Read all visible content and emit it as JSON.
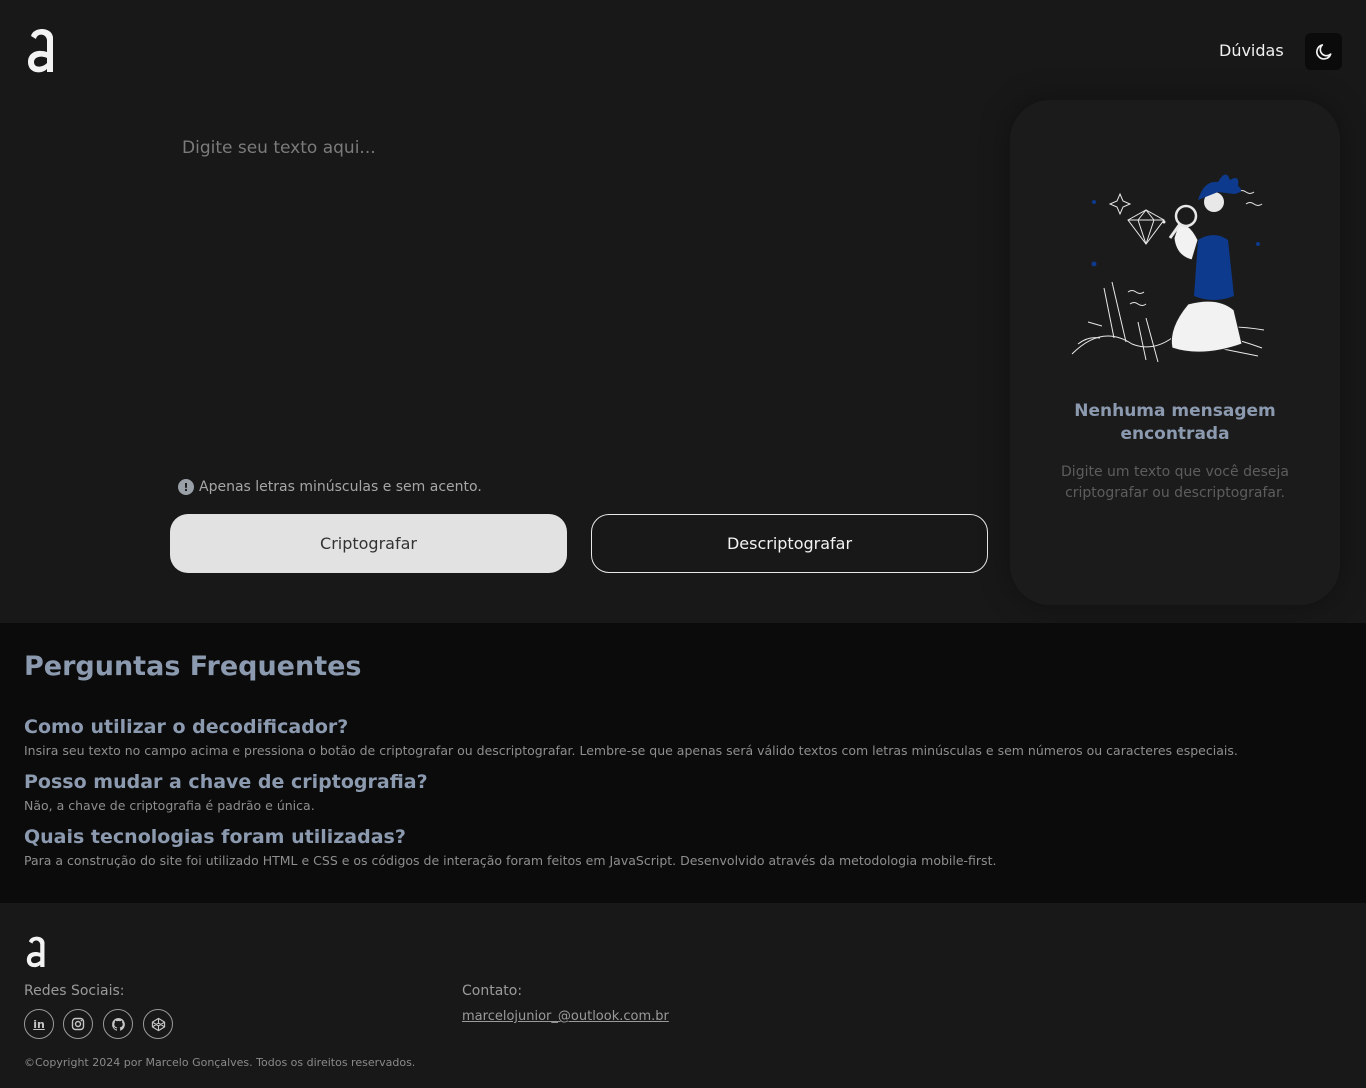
{
  "header": {
    "logo_letter": "a",
    "nav_link": "Dúvidas",
    "theme_icon": "moon-icon"
  },
  "input": {
    "placeholder": "Digite seu texto aqui...",
    "hint": "Apenas letras minúsculas e sem acento."
  },
  "buttons": {
    "encrypt": "Criptografar",
    "decrypt": "Descriptografar"
  },
  "output": {
    "illustration": "person-with-magnifying-glass-illustration",
    "title": "Nenhuma mensagem encontrada",
    "description": "Digite um texto que você deseja criptografar ou descriptografar."
  },
  "faq": {
    "title": "Perguntas Frequentes",
    "items": [
      {
        "question": "Como utilizar o decodificador?",
        "answer": "Insira seu texto no campo acima e pressiona o botão de criptografar ou descriptografar. Lembre-se que apenas será válido textos com letras minúsculas e sem números ou caracteres especiais."
      },
      {
        "question": "Posso mudar a chave de criptografia?",
        "answer": "Não, a chave de criptografia é padrão e única."
      },
      {
        "question": "Quais tecnologias foram utilizadas?",
        "answer": "Para a construção do site foi utilizado HTML e CSS e os códigos de interação foram feitos em JavaScript. Desenvolvido através da metodologia mobile-first."
      }
    ]
  },
  "footer": {
    "social_label": "Redes Sociais:",
    "social_icons": [
      "linkedin-icon",
      "instagram-icon",
      "github-icon",
      "codepen-icon"
    ],
    "contact_label": "Contato:",
    "email": "marcelojunior_@outlook.com.br",
    "copyright": "©Copyright 2024 por Marcelo Gonçalves. Todos os direitos reservados."
  },
  "colors": {
    "background": "#181818",
    "faq_background": "#0b0b0b",
    "accent": "#8c9ab0",
    "illustration_blue": "#0d3a8c"
  }
}
